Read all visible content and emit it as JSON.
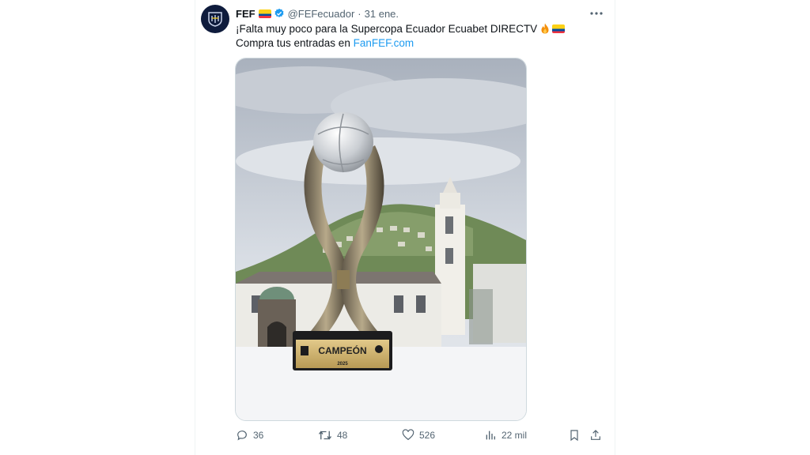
{
  "tweet": {
    "author_name": "FEF",
    "handle": "@FEFecuador",
    "separator": "·",
    "date": "31 ene.",
    "line1": "¡Falta muy poco para la Supercopa Ecuador Ecuabet DIRECTV",
    "line2_prefix": "Compra tus entradas en ",
    "link_text": "FanFEF.com",
    "trophy_plaque_text": "CAMPEÓN",
    "trophy_year": "2025",
    "avatar_icon": "fef-shield-icon",
    "more_icon": "more-dots-icon"
  },
  "actions": {
    "replies": "36",
    "retweets": "48",
    "likes": "526",
    "views": "22 mil"
  },
  "colors": {
    "link": "#1d9bf0",
    "muted": "#536471",
    "verified": "#1d9bf0",
    "avatar_bg": "#0e1b3c"
  }
}
